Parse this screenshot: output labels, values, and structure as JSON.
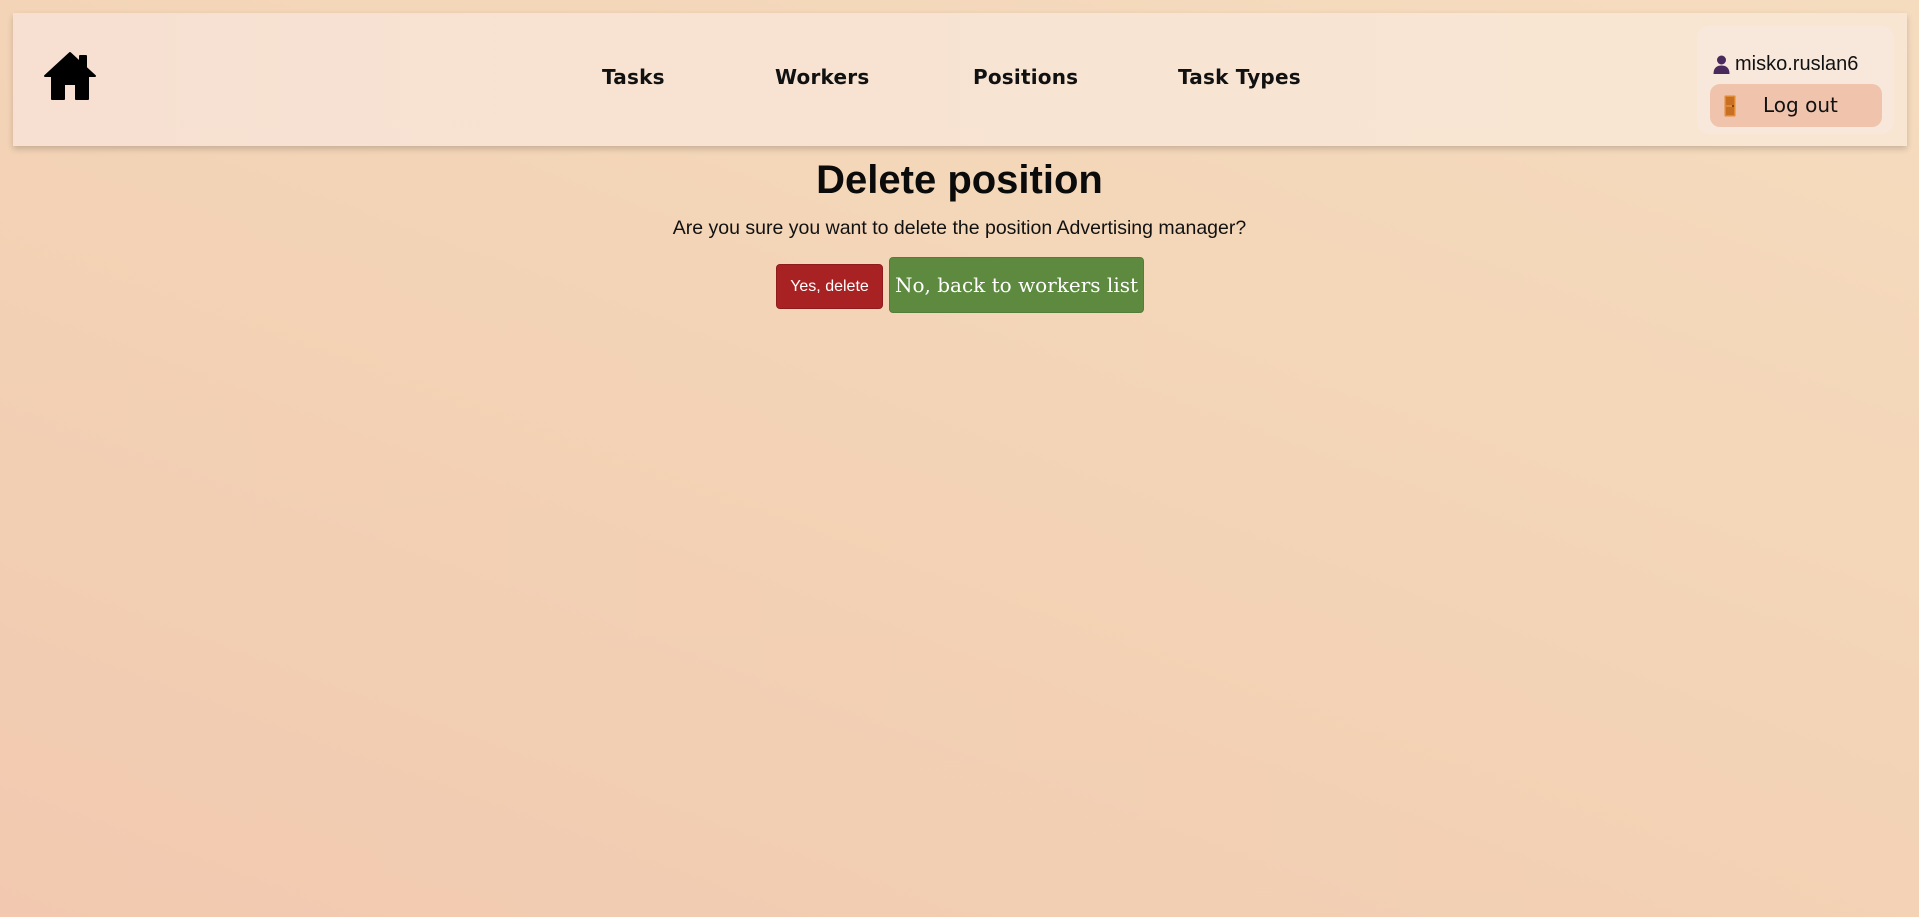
{
  "nav": {
    "links": [
      {
        "label": "Tasks"
      },
      {
        "label": "Workers"
      },
      {
        "label": "Positions"
      },
      {
        "label": "Task Types"
      }
    ],
    "home_icon": "home-icon"
  },
  "user": {
    "username": "misko.ruslan6",
    "user_icon": "user-icon",
    "logout_label": "Log out",
    "logout_icon": "door-icon"
  },
  "main": {
    "title": "Delete position",
    "confirm_text": "Are you sure you want to delete the position Advertising manager?",
    "confirm_button": "Yes, delete",
    "cancel_button": "No, back to workers list"
  },
  "colors": {
    "delete_button": "#a82224",
    "back_button": "#5d8a3f",
    "logout_button": "#f0c3ad",
    "user_icon": "#4a2a5c",
    "door_icon": "#e08a34"
  }
}
